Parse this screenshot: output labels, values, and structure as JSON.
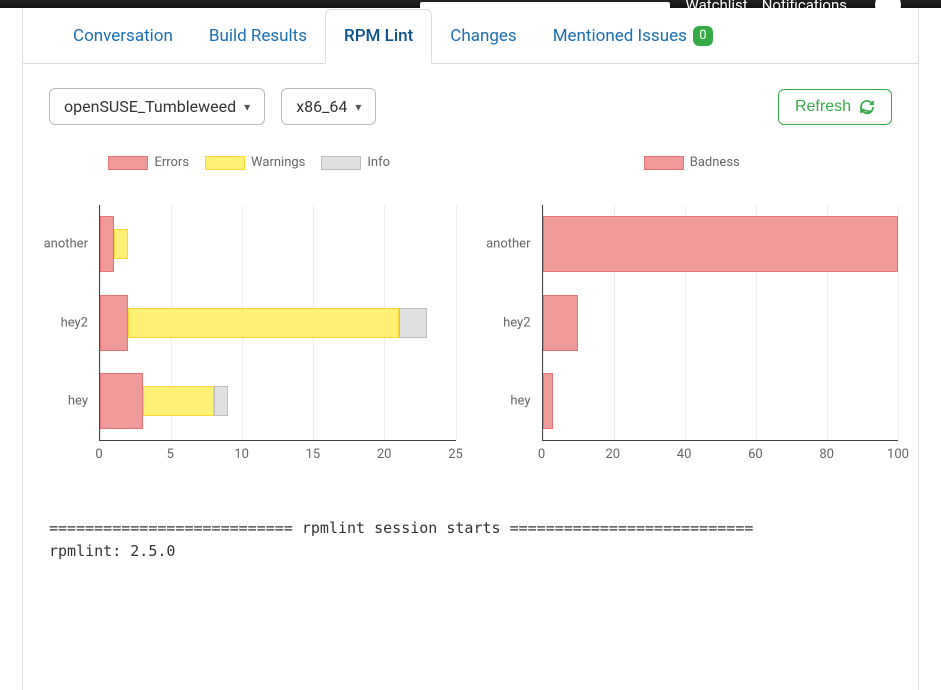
{
  "topnav": {
    "search_placeholder": "",
    "watchlist": "Watchlist",
    "notifications": "Notifications"
  },
  "tabs": {
    "conversation": "Conversation",
    "build_results": "Build Results",
    "rpm_lint": "RPM Lint",
    "changes": "Changes",
    "mentioned_issues": "Mentioned Issues",
    "mentioned_badge": "0"
  },
  "filters": {
    "distro": "openSUSE_Tumbleweed",
    "arch": "x86_64"
  },
  "actions": {
    "refresh": "Refresh"
  },
  "legend_left": {
    "errors": "Errors",
    "warnings": "Warnings",
    "info": "Info"
  },
  "legend_right": {
    "badness": "Badness"
  },
  "chart_data": [
    {
      "type": "bar",
      "orientation": "horizontal",
      "stacked": true,
      "categories": [
        "another",
        "hey2",
        "hey"
      ],
      "series": [
        {
          "name": "Errors",
          "values": [
            1,
            2,
            3
          ]
        },
        {
          "name": "Warnings",
          "values": [
            1,
            19,
            5
          ]
        },
        {
          "name": "Info",
          "values": [
            0,
            2,
            1
          ]
        }
      ],
      "xlim": [
        0,
        25
      ],
      "xticks": [
        0,
        5,
        10,
        15,
        20,
        25
      ],
      "title": "",
      "xlabel": "",
      "ylabel": ""
    },
    {
      "type": "bar",
      "orientation": "horizontal",
      "categories": [
        "another",
        "hey2",
        "hey"
      ],
      "series": [
        {
          "name": "Badness",
          "values": [
            100,
            10,
            3
          ]
        }
      ],
      "xlim": [
        0,
        100
      ],
      "xticks": [
        0,
        20,
        40,
        60,
        80,
        100
      ],
      "title": "",
      "xlabel": "",
      "ylabel": ""
    }
  ],
  "log": {
    "line1": "=========================== rpmlint session starts ===========================",
    "line2": "rpmlint: 2.5.0"
  },
  "colors": {
    "link": "#1a6fb3",
    "accent_green": "#35ab45",
    "errors_fill": "#ef9a9a",
    "errors_stroke": "#e57373",
    "warnings_fill": "#fff176",
    "warnings_stroke": "#fdd835",
    "info_fill": "#e0e0e0",
    "info_stroke": "#bdbdbd"
  }
}
